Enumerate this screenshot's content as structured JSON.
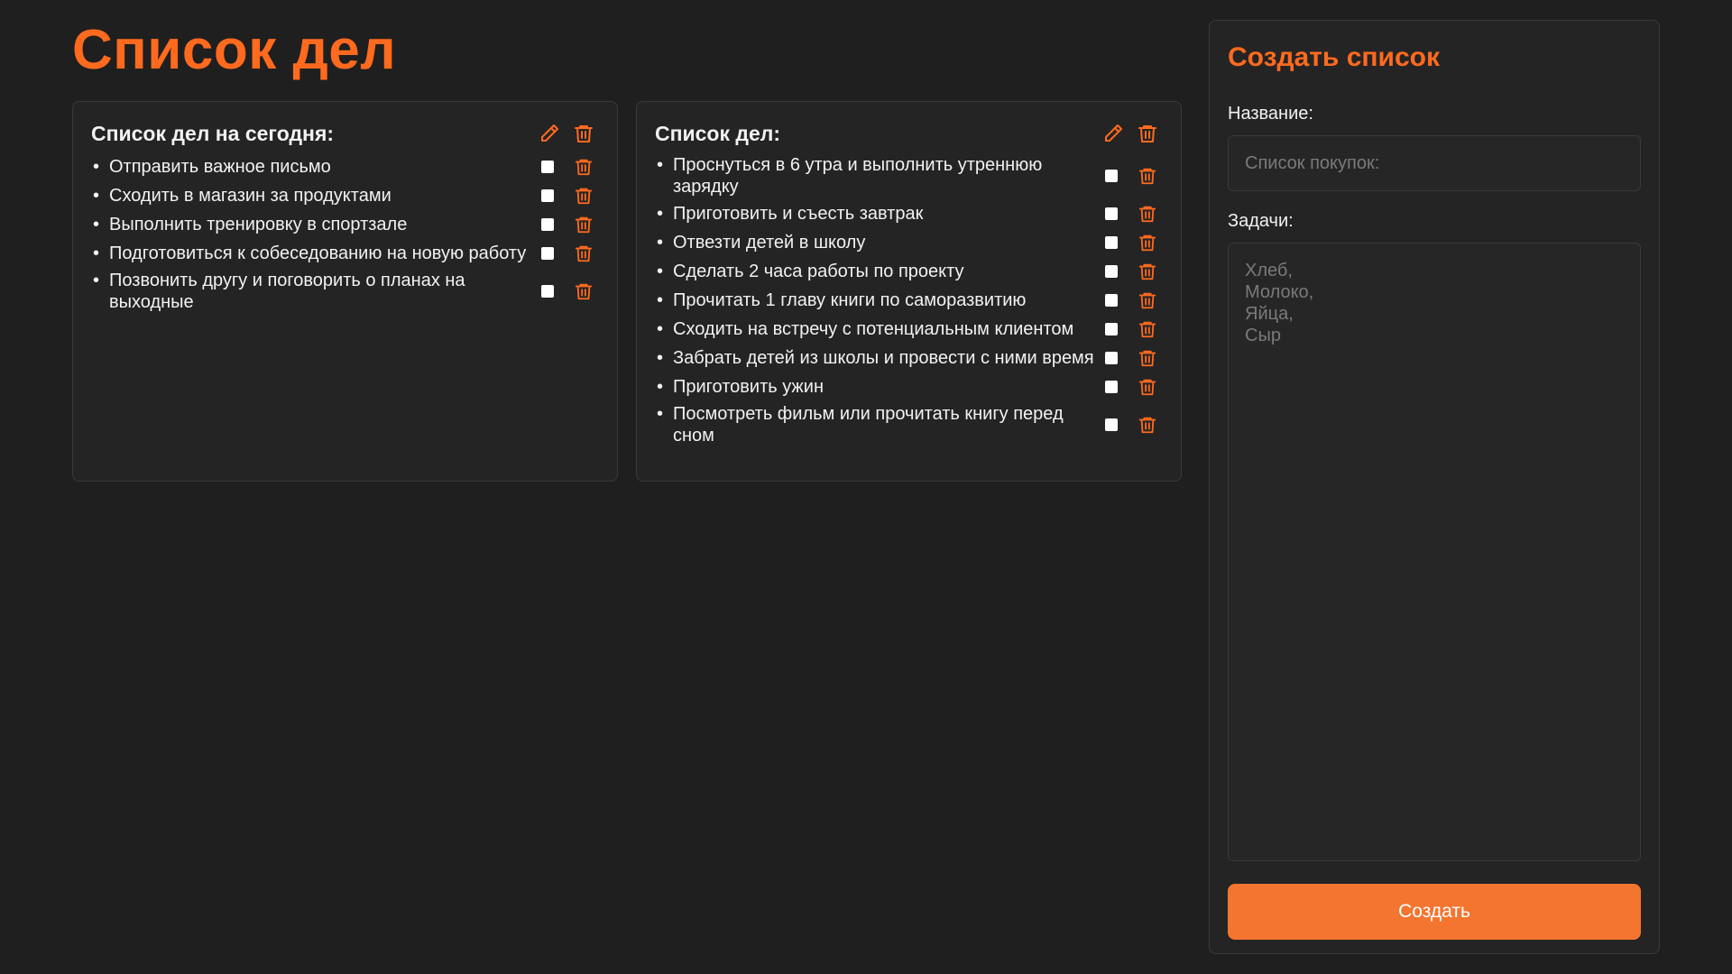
{
  "page_title": "Список дел",
  "colors": {
    "accent": "#ff6a1f",
    "button": "#f47530",
    "background": "#1f1f1f",
    "card": "#242424"
  },
  "lists": [
    {
      "title": "Список дел на сегодня:",
      "tasks": [
        "Отправить важное письмо",
        "Сходить в магазин за продуктами",
        "Выполнить тренировку в спортзале",
        "Подготовиться к собеседованию на новую работу",
        "Позвонить другу и поговорить о планах на выходные"
      ]
    },
    {
      "title": "Список дел:",
      "tasks": [
        "Проснуться в 6 утра и выполнить утреннюю зарядку",
        "Приготовить и съесть завтрак",
        "Отвезти детей в школу",
        "Сделать 2 часа работы по проекту",
        "Прочитать 1 главу книги по саморазвитию",
        "Сходить на встречу с потенциальным клиентом",
        "Забрать детей из школы и провести с ними время",
        "Приготовить ужин",
        "Посмотреть фильм или прочитать книгу перед сном"
      ]
    }
  ],
  "create_form": {
    "title": "Создать список",
    "name_label": "Название:",
    "name_placeholder": "Список покупок:",
    "tasks_label": "Задачи:",
    "tasks_placeholder": "Хлеб,\nМолоко,\nЯйца,\nСыр",
    "submit_label": "Создать"
  },
  "icons": {
    "edit": "pencil-icon",
    "delete": "trash-icon"
  }
}
